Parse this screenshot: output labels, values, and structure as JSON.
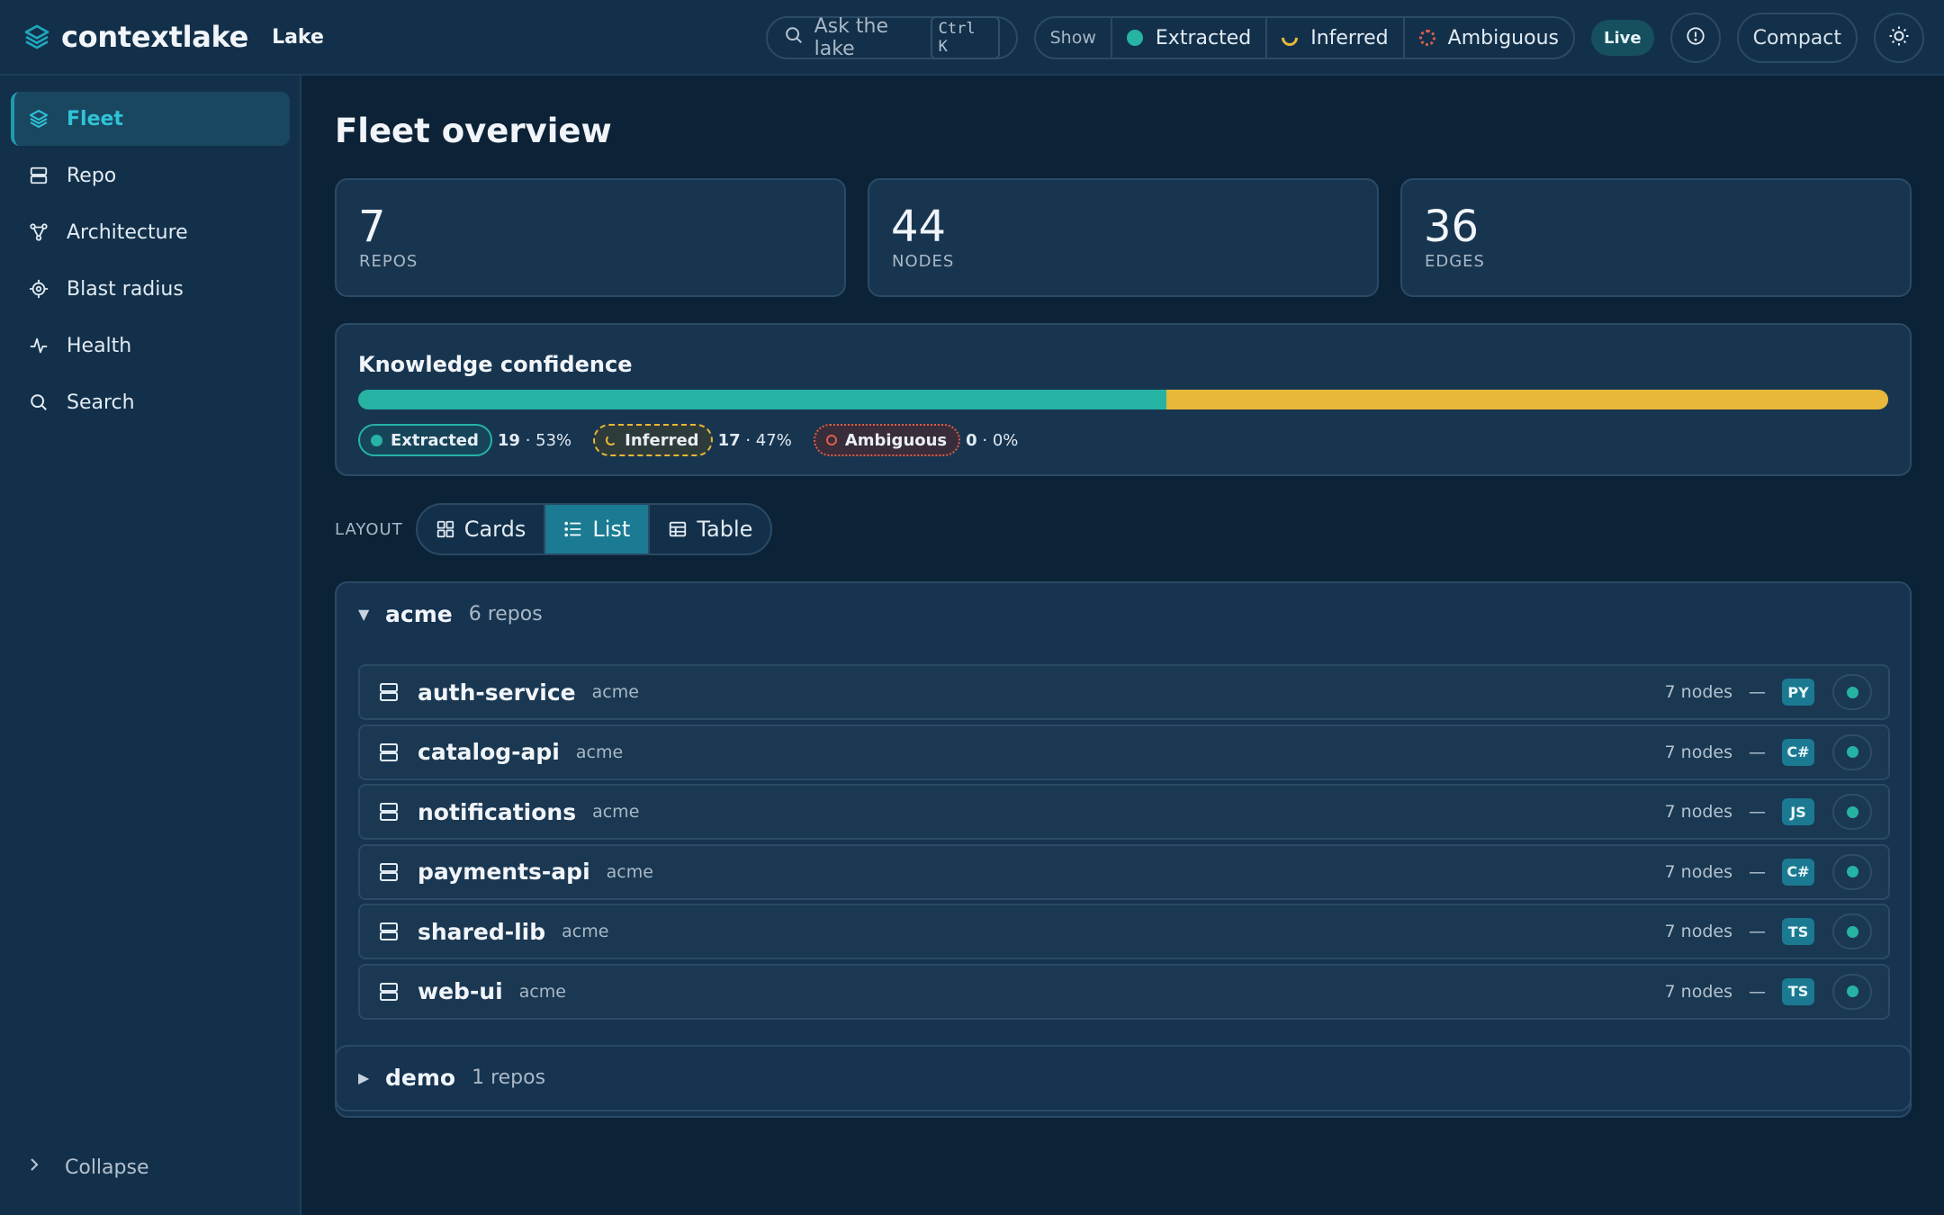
{
  "app": {
    "name": "contextlake",
    "context": "Lake"
  },
  "topbar": {
    "search_placeholder": "Ask the lake",
    "search_shortcut": "Ctrl K",
    "show_label": "Show",
    "filters": [
      {
        "label": "Extracted",
        "icon": "extracted-dot-icon"
      },
      {
        "label": "Inferred",
        "icon": "inferred-arc-icon"
      },
      {
        "label": "Ambiguous",
        "icon": "ambiguous-dashed-icon"
      }
    ],
    "live_label": "Live",
    "info_icon": "info-icon",
    "compact_label": "Compact",
    "theme_icon": "sun-icon"
  },
  "sidebar": {
    "items": [
      {
        "label": "Fleet",
        "icon": "layers-icon",
        "active": true
      },
      {
        "label": "Repo",
        "icon": "server-icon",
        "active": false
      },
      {
        "label": "Architecture",
        "icon": "graph-icon",
        "active": false
      },
      {
        "label": "Blast radius",
        "icon": "target-icon",
        "active": false
      },
      {
        "label": "Health",
        "icon": "pulse-icon",
        "active": false
      },
      {
        "label": "Search",
        "icon": "search-icon",
        "active": false
      }
    ],
    "collapse_label": "Collapse"
  },
  "main": {
    "title": "Fleet overview",
    "stats": [
      {
        "value": "7",
        "label": "REPOS"
      },
      {
        "value": "44",
        "label": "NODES"
      },
      {
        "value": "36",
        "label": "EDGES"
      }
    ],
    "confidence": {
      "title": "Knowledge confidence",
      "segments": [
        {
          "label": "Extracted",
          "count": "19",
          "percent": "53%",
          "fraction": 0.528,
          "color": "#26b3a3"
        },
        {
          "label": "Inferred",
          "count": "17",
          "percent": "47%",
          "fraction": 0.472,
          "color": "#e8b83a"
        },
        {
          "label": "Ambiguous",
          "count": "0",
          "percent": "0%",
          "fraction": 0,
          "color": "#d9604c"
        }
      ]
    },
    "layout": {
      "label": "LAYOUT",
      "options": [
        {
          "label": "Cards",
          "icon": "grid-icon",
          "active": false
        },
        {
          "label": "List",
          "icon": "list-icon",
          "active": true
        },
        {
          "label": "Table",
          "icon": "table-icon",
          "active": false
        }
      ]
    },
    "groups": [
      {
        "name": "acme",
        "count": "6 repos",
        "expanded": true,
        "repos": [
          {
            "name": "auth-service",
            "org": "acme",
            "nodes": "7 nodes",
            "dash": "—",
            "lang": "PY"
          },
          {
            "name": "catalog-api",
            "org": "acme",
            "nodes": "7 nodes",
            "dash": "—",
            "lang": "C#"
          },
          {
            "name": "notifications",
            "org": "acme",
            "nodes": "7 nodes",
            "dash": "—",
            "lang": "JS"
          },
          {
            "name": "payments-api",
            "org": "acme",
            "nodes": "7 nodes",
            "dash": "—",
            "lang": "C#"
          },
          {
            "name": "shared-lib",
            "org": "acme",
            "nodes": "7 nodes",
            "dash": "—",
            "lang": "TS"
          },
          {
            "name": "web-ui",
            "org": "acme",
            "nodes": "7 nodes",
            "dash": "—",
            "lang": "TS"
          }
        ]
      },
      {
        "name": "demo",
        "count": "1 repos",
        "expanded": false,
        "repos": []
      }
    ]
  }
}
